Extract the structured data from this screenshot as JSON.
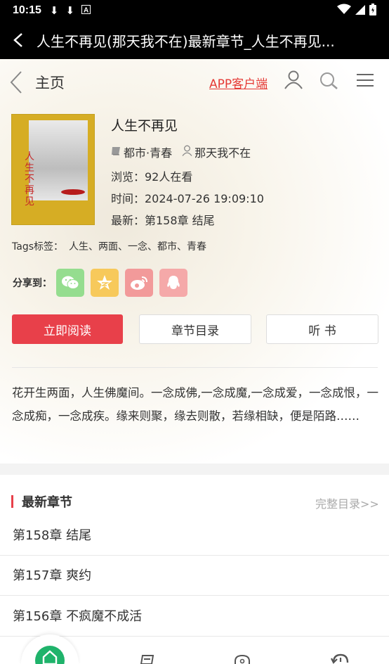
{
  "status_bar": {
    "time": "10:15",
    "icons": [
      "download-icon",
      "download-icon",
      "notification-a-icon",
      "wifi-icon",
      "signal-icon",
      "battery-icon"
    ]
  },
  "app_bar": {
    "title": "人生不再见(那天我不在)最新章节_人生不再见..."
  },
  "top_nav": {
    "home_label": "主页",
    "app_link": "APP客户端"
  },
  "book": {
    "title": "人生不再见",
    "category": "都市·青春",
    "author": "那天我不在",
    "views": "浏览：92人在看",
    "time": "时间：2024-07-26 19:09:10",
    "latest": "最新：第158章 结尾",
    "cover_text": "人生不再见"
  },
  "tags": {
    "label": "Tags标签：",
    "value": "人生、两面、一念、都市、青春"
  },
  "share": {
    "label": "分享到：",
    "targets": [
      "wechat",
      "qzone",
      "weibo",
      "qq"
    ]
  },
  "buttons": {
    "read": "立即阅读",
    "toc": "章节目录",
    "listen": "听 书"
  },
  "intro": "花开生两面，人生佛魔间。一念成佛,一念成魔,一念成爱，一念成恨，一念成痴，一念成疾。缘来则聚，缘去则散，若缘相缺，便是陌路……",
  "latest_section": {
    "title": "最新章节",
    "full_toc": "完整目录>>",
    "chapters": [
      "第158章 结尾",
      "第157章 爽约",
      "第156章 不疯魔不成活"
    ]
  },
  "colors": {
    "accent": "#e8404a",
    "link": "#e53935",
    "wechat": "#95dd8f",
    "qzone": "#f7c95b",
    "weibo": "#f29a9a",
    "qq": "#f5a9a9",
    "home_tab": "#1fb36b"
  }
}
